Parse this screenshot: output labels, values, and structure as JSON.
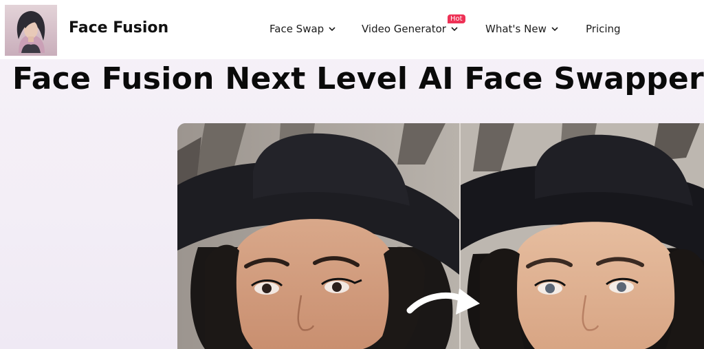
{
  "header": {
    "logo_icon": "woman-portrait-logo",
    "brand": "Face Fusion",
    "nav": [
      {
        "label": "Face Swap",
        "icon": "chevron-down-icon"
      },
      {
        "label": "Video Generator",
        "icon": "chevron-down-icon",
        "badge": "Hot"
      },
      {
        "label": "What's New",
        "icon": "chevron-down-icon"
      },
      {
        "label": "Pricing"
      }
    ]
  },
  "hero": {
    "title": "Face Fusion Next Level AI Face Swapper"
  },
  "comparison": {
    "before_image": "woman-in-black-hat-original",
    "after_image": "woman-in-black-hat-swapped",
    "arrow_icon": "curved-arrow-right-icon"
  },
  "colors": {
    "badge": "#ee3256",
    "text": "#0a0a0a",
    "background": "#f4eff7"
  }
}
